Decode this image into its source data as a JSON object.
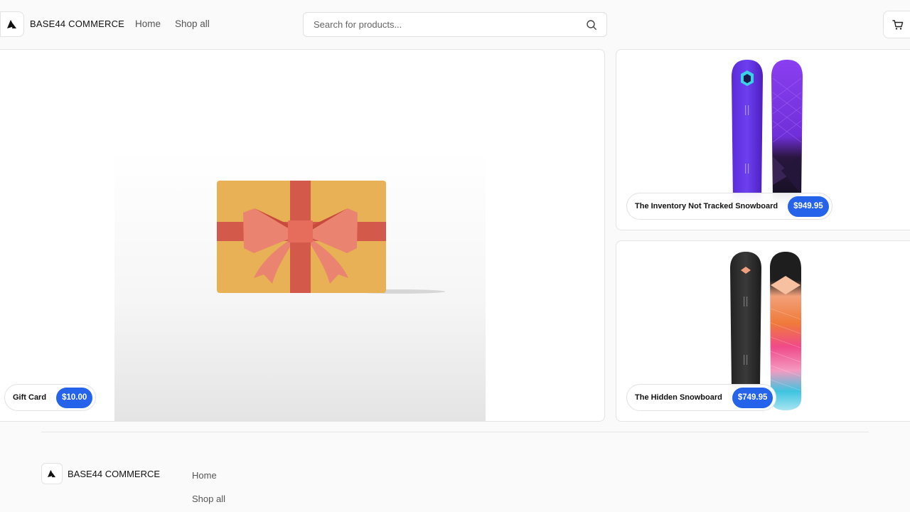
{
  "header": {
    "brand": "BASE44 COMMERCE",
    "nav": [
      {
        "label": "Home"
      },
      {
        "label": "Shop all"
      }
    ],
    "search": {
      "placeholder": "Search for products...",
      "value": ""
    },
    "icons": {
      "logo": "triangle-logo-icon",
      "search": "search-icon",
      "cart": "cart-icon"
    }
  },
  "products": [
    {
      "title": "Gift Card",
      "price": "$10.00"
    },
    {
      "title": "The Inventory Not Tracked Snowboard",
      "price": "$949.95"
    },
    {
      "title": "The Hidden Snowboard",
      "price": "$749.95"
    }
  ],
  "footer": {
    "brand": "BASE44 COMMERCE",
    "links": [
      {
        "label": "Home"
      },
      {
        "label": "Shop all"
      }
    ]
  },
  "colors": {
    "accent": "#2563eb",
    "background": "#fafafa",
    "border": "#e4e4e4"
  }
}
